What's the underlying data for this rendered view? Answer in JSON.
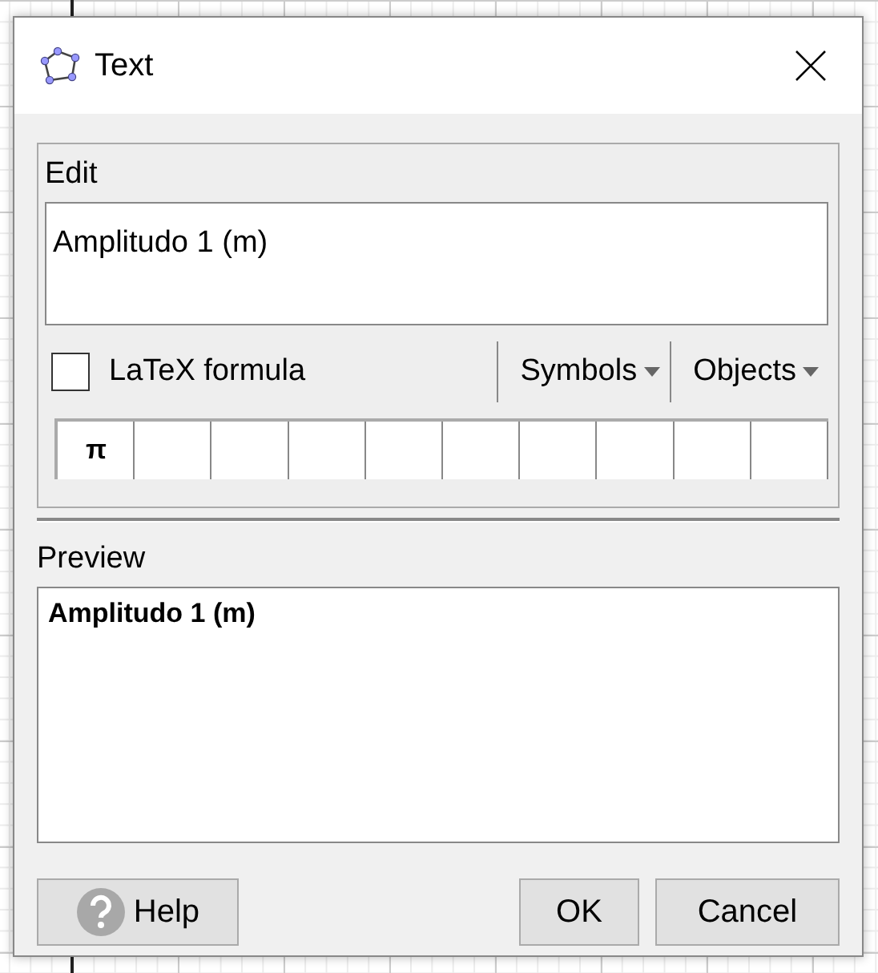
{
  "window": {
    "title": "Text"
  },
  "edit": {
    "label": "Edit",
    "value": "Amplitudo 1 (m)"
  },
  "latex": {
    "label": "LaTeX formula",
    "checked": false
  },
  "menus": [
    "Symbols",
    "Objects"
  ],
  "symbols": [
    "π"
  ],
  "preview": {
    "label": "Preview",
    "text": "Amplitudo 1 (m)"
  },
  "buttons": {
    "help": "Help",
    "ok": "OK",
    "cancel": "Cancel"
  }
}
